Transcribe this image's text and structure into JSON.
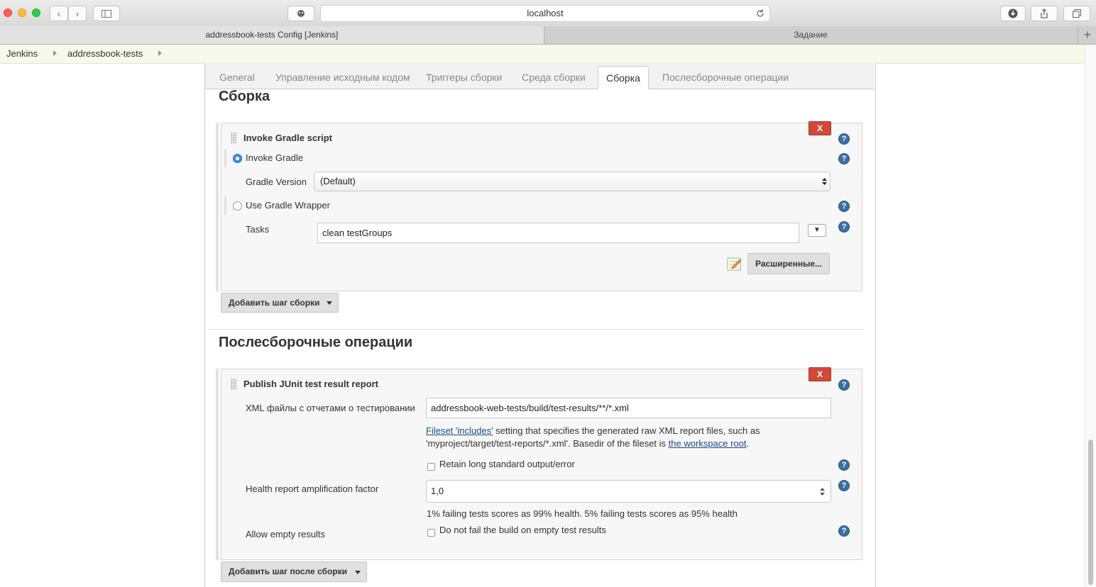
{
  "browser": {
    "url": "localhost",
    "tabs": [
      "addressbook-tests Config [Jenkins]",
      "Задание"
    ]
  },
  "breadcrumb": [
    "Jenkins",
    "addressbook-tests"
  ],
  "config_tabs": [
    "General",
    "Управление исходным кодом",
    "Триггеры сборки",
    "Среда сборки",
    "Сборка",
    "Послесборочные операции"
  ],
  "build": {
    "section_title": "Сборка",
    "step_title": "Invoke Gradle script",
    "invoke_gradle_label": "Invoke Gradle",
    "gradle_version_label": "Gradle Version",
    "gradle_version_value": "(Default)",
    "use_wrapper_label": "Use Gradle Wrapper",
    "tasks_label": "Tasks",
    "tasks_value": "clean testGroups",
    "advanced_label": "Расширенные...",
    "add_step_label": "Добавить шаг сборки"
  },
  "post": {
    "section_title": "Послесборочные операции",
    "step_title": "Publish JUnit test result report",
    "xml_label": "XML файлы с отчетами о тестировании",
    "xml_value": "addressbook-web-tests/build/test-results/**/*.xml",
    "desc_link1": "Fileset 'includes'",
    "desc_text1": " setting that specifies the generated raw XML report files, such as",
    "desc_text2": "'myproject/target/test-reports/*.xml'. Basedir of the fileset is ",
    "desc_link2": "the workspace root",
    "desc_end": ".",
    "retain_label": "Retain long standard output/error",
    "health_label": "Health report amplification factor",
    "health_value": "1,0",
    "health_desc": "1% failing tests scores as 99% health. 5% failing tests scores as 95% health",
    "allow_empty_label": "Allow empty results",
    "no_fail_label": "Do not fail the build on empty test results",
    "add_post_label": "Добавить шаг после сборки"
  },
  "icons": {
    "delete_label": "X",
    "help_glyph": "?",
    "dropdown_glyph": "▼"
  }
}
